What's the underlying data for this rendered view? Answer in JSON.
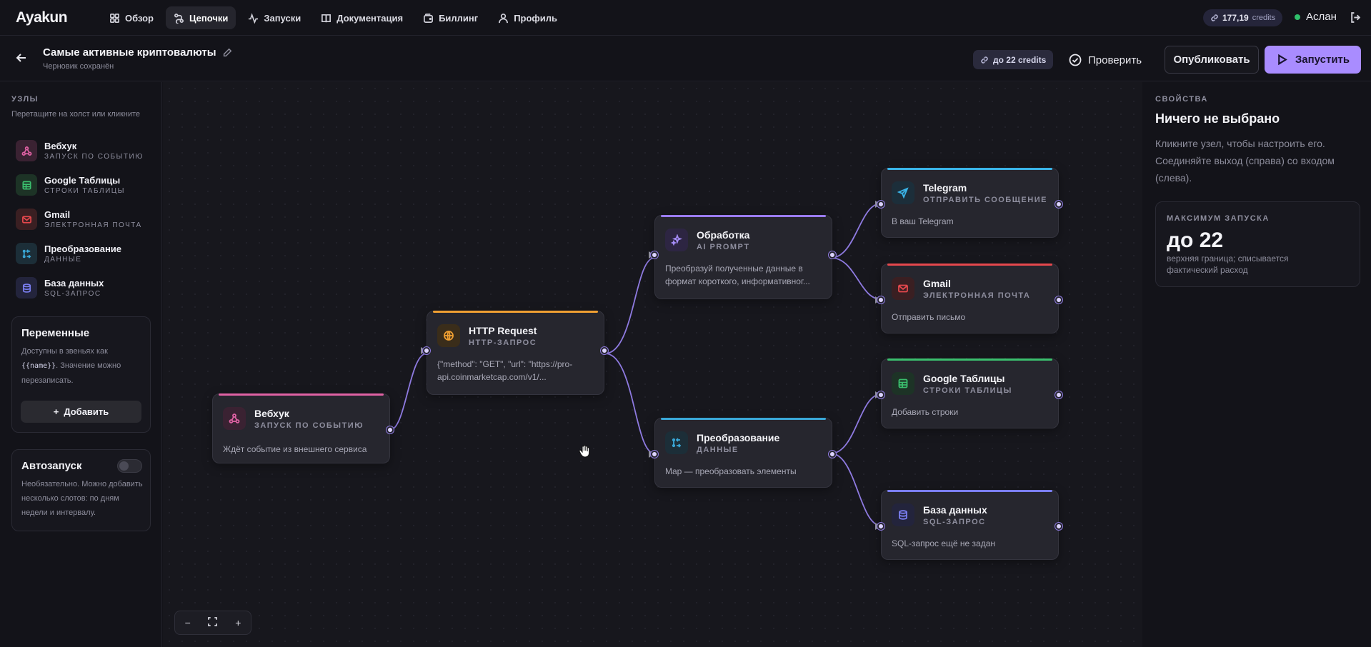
{
  "app": {
    "logo": "Ayakun"
  },
  "nav": [
    {
      "label": "Обзор",
      "icon": "grid-icon"
    },
    {
      "label": "Цепочки",
      "icon": "chain-icon",
      "active": true
    },
    {
      "label": "Запуски",
      "icon": "activity-icon"
    },
    {
      "label": "Документация",
      "icon": "book-icon"
    },
    {
      "label": "Биллинг",
      "icon": "wallet-icon"
    },
    {
      "label": "Профиль",
      "icon": "user-icon"
    }
  ],
  "account": {
    "credits_value": "177,19",
    "credits_unit": "credits",
    "user_name": "Аслан",
    "online": true
  },
  "chain": {
    "title": "Самые активные криптовалюты",
    "status": "Черновик сохранён",
    "limit_label": "до 22 credits",
    "check_label": "Проверить",
    "publish_label": "Опубликовать",
    "run_label": "Запустить"
  },
  "sidebar": {
    "section_label": "УЗЛЫ",
    "hint": "Перетащите на холст или кликните",
    "palette": [
      {
        "name": "Вебхук",
        "sub": "ЗАПУСК ПО СОБЫТИЮ",
        "icon": "webhook-icon",
        "color": "#e062a4"
      },
      {
        "name": "Google Таблицы",
        "sub": "СТРОКИ ТАБЛИЦЫ",
        "icon": "sheet-icon",
        "color": "#3bbf6e"
      },
      {
        "name": "Gmail",
        "sub": "ЭЛЕКТРОННАЯ ПОЧТА",
        "icon": "mail-icon",
        "color": "#e5484d"
      },
      {
        "name": "Преобразование",
        "sub": "ДАННЫЕ",
        "icon": "transform-icon",
        "color": "#3aa8d8"
      },
      {
        "name": "База данных",
        "sub": "SQL-ЗАПРОС",
        "icon": "database-icon",
        "color": "#7a7ef0"
      }
    ],
    "variables": {
      "title": "Переменные",
      "text_before": "Доступны в звеньях как",
      "code": "{{name}}",
      "text_after": ". Значение можно перезаписать.",
      "add_label": "Добавить"
    },
    "autorun": {
      "title": "Автозапуск",
      "enabled": false,
      "text": "Необязательно. Можно добавить несколько слотов: по дням недели и интервалу."
    }
  },
  "canvas": {
    "nodes": [
      {
        "id": "webhook",
        "title": "Вебхук",
        "sub": "ЗАПУСК ПО СОБЫТИЮ",
        "desc": "Ждёт событие из внешнего сервиса",
        "icon": "webhook-icon",
        "color": "#e062a4"
      },
      {
        "id": "http",
        "title": "HTTP Request",
        "sub": "HTTP-ЗАПРОС",
        "desc": "{\"method\": \"GET\", \"url\": \"https://pro-api.coinmarketcap.com/v1/...",
        "icon": "globe-icon",
        "color": "#f0a032"
      },
      {
        "id": "ai",
        "title": "Обработка",
        "sub": "AI PROMPT",
        "desc": "Преобразуй полученные данные в формат короткого, информативног...",
        "icon": "sparkle-icon",
        "color": "#9a7cf5"
      },
      {
        "id": "transform",
        "title": "Преобразование",
        "sub": "ДАННЫЕ",
        "desc": "Map — преобразовать элементы",
        "icon": "transform-icon",
        "color": "#3aa8d8"
      },
      {
        "id": "telegram",
        "title": "Telegram",
        "sub": "ОТПРАВИТЬ СООБЩЕНИЕ",
        "desc": "В ваш Telegram",
        "icon": "send-icon",
        "color": "#3ab4e8"
      },
      {
        "id": "gmail",
        "title": "Gmail",
        "sub": "ЭЛЕКТРОННАЯ ПОЧТА",
        "desc": "Отправить письмо",
        "icon": "mail-icon",
        "color": "#e5484d"
      },
      {
        "id": "sheets",
        "title": "Google Таблицы",
        "sub": "СТРОКИ ТАБЛИЦЫ",
        "desc": "Добавить строки",
        "icon": "sheet-icon",
        "color": "#3bbf6e"
      },
      {
        "id": "db",
        "title": "База данных",
        "sub": "SQL-ЗАПРОС",
        "desc": "SQL-запрос ещё не задан",
        "icon": "database-icon",
        "color": "#7a7ef0"
      }
    ],
    "edge_color": "#8e7ae0",
    "zoom_controls": {
      "minus": "−",
      "plus": "+"
    }
  },
  "properties": {
    "section_label": "СВОЙСТВА",
    "title": "Ничего не выбрано",
    "text": "Кликните узел, чтобы настроить его. Соединяйте выход (справа) со входом (слева).",
    "max_label": "МАКСИМУМ ЗАПУСКА",
    "max_value": "до 22",
    "max_desc": "верхняя граница; списывается фактический расход"
  }
}
